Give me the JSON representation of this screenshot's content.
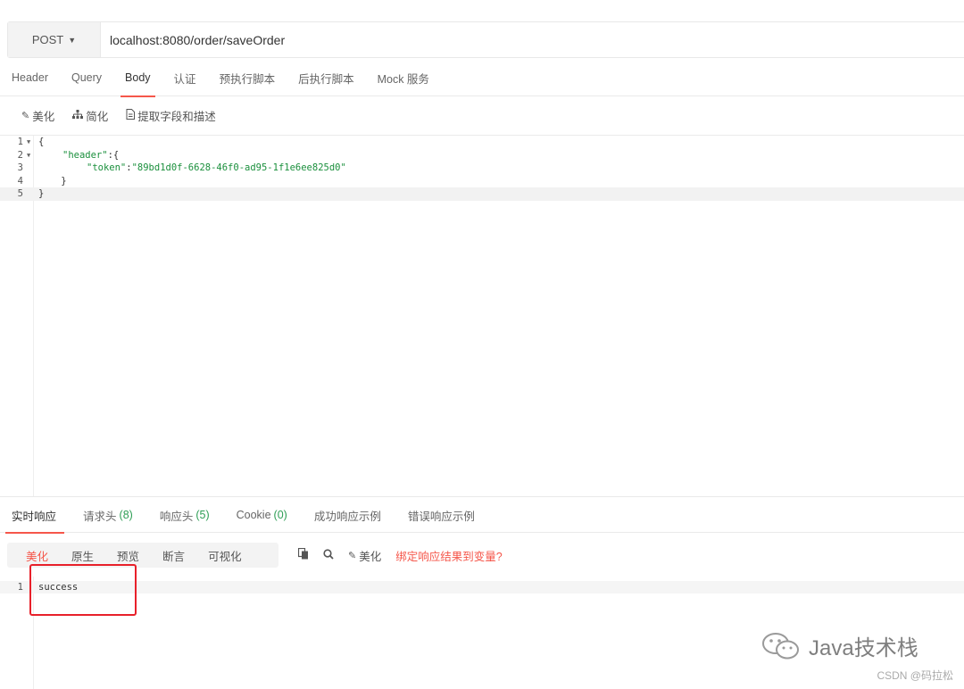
{
  "request": {
    "method": "POST",
    "url": "localhost:8080/order/saveOrder"
  },
  "request_tabs": [
    {
      "label": "Header",
      "active": false
    },
    {
      "label": "Query",
      "active": false
    },
    {
      "label": "Body",
      "active": true
    },
    {
      "label": "认证",
      "active": false
    },
    {
      "label": "预执行脚本",
      "active": false
    },
    {
      "label": "后执行脚本",
      "active": false
    },
    {
      "label": "Mock 服务",
      "active": false
    }
  ],
  "body_tools": {
    "beautify": "美化",
    "simplify": "简化",
    "extract": "提取字段和描述"
  },
  "editor": {
    "lines": [
      {
        "num": "1",
        "text": "{"
      },
      {
        "num": "2",
        "key": "\"header\"",
        "rest": ":{"
      },
      {
        "num": "3",
        "key": "\"token\"",
        "sep": ":",
        "value": "\"89bd1d0f-6628-46f0-ad95-1f1e6ee825d0\""
      },
      {
        "num": "4",
        "text": "    }"
      },
      {
        "num": "5",
        "text": "}"
      }
    ]
  },
  "response_tabs": [
    {
      "label": "实时响应",
      "count": "",
      "active": true
    },
    {
      "label": "请求头",
      "count": "(8)",
      "active": false
    },
    {
      "label": "响应头",
      "count": "(5)",
      "active": false
    },
    {
      "label": "Cookie",
      "count": "(0)",
      "active": false
    },
    {
      "label": "成功响应示例",
      "count": "",
      "active": false
    },
    {
      "label": "错误响应示例",
      "count": "",
      "active": false
    }
  ],
  "response_view": {
    "modes": [
      "美化",
      "原生",
      "预览",
      "断言",
      "可视化"
    ],
    "active_mode": "美化",
    "beautify": "美化",
    "bind_link": "绑定响应结果到变量?"
  },
  "response": {
    "line_num": "1",
    "text": "success"
  },
  "watermark": {
    "text": "Java技术栈",
    "csdn": "CSDN @码拉松"
  },
  "colors": {
    "accent": "#f5564a",
    "string": "#1a8f3c",
    "count": "#2e9e55",
    "highlight_box": "#e8202a"
  }
}
